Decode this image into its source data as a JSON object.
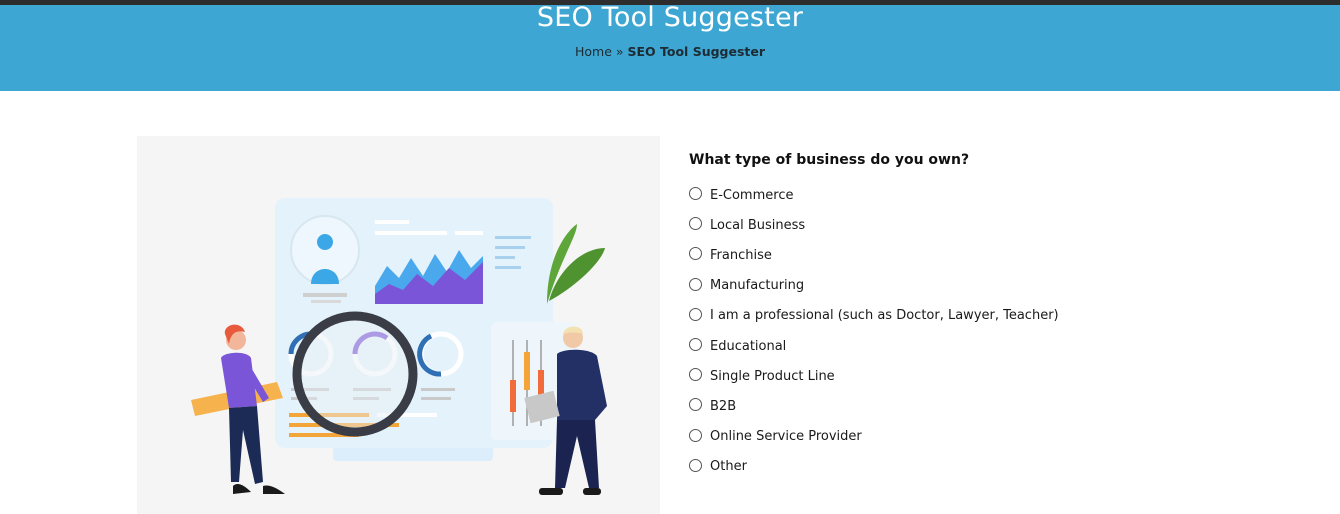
{
  "header": {
    "title": "SEO Tool Suggester",
    "breadcrumb": {
      "home": "Home",
      "separator": " » ",
      "current": "SEO Tool Suggester"
    }
  },
  "illustration": {
    "icon": "seo-analytics-illustration"
  },
  "question": {
    "title": "What type of business do you own?",
    "options": [
      "E-Commerce",
      "Local Business",
      "Franchise",
      "Manufacturing",
      "I am a professional (such as Doctor, Lawyer, Teacher)",
      "Educational",
      "Single Product Line",
      "B2B",
      "Online Service Provider",
      "Other"
    ]
  },
  "colors": {
    "header_bg": "#3ea6d3",
    "topbar": "#2d2d2d",
    "title_text": "#ffffff"
  }
}
